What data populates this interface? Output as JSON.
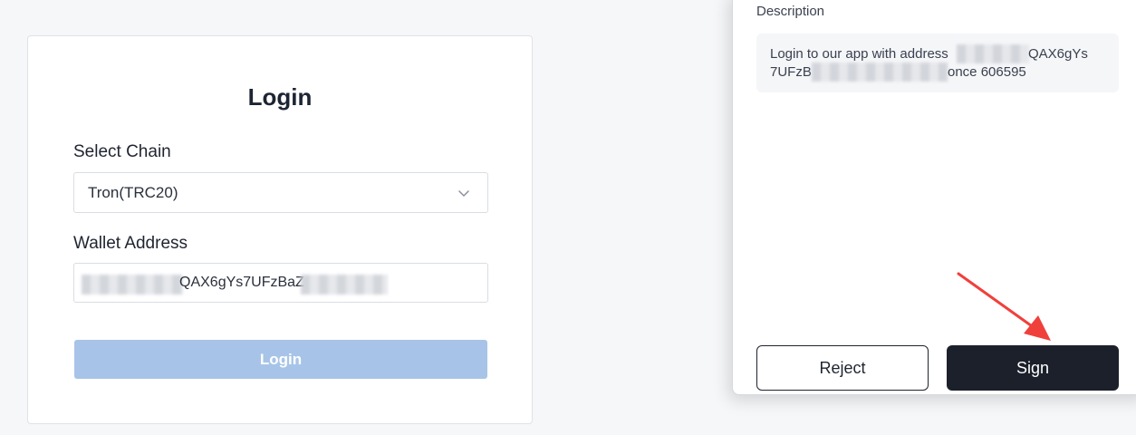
{
  "login": {
    "title": "Login",
    "chain_label": "Select Chain",
    "chain_value": "Tron(TRC20)",
    "address_label": "Wallet Address",
    "address_value_visible": "QAX6gYs7UFzBaZ",
    "button_label": "Login"
  },
  "popup": {
    "description_label": "Description",
    "description_line1": "Login to our app with address",
    "description_line1_end": "QAX6gYs",
    "description_line2_start": "7UFzB",
    "description_line2_end": "once 606595",
    "reject_label": "Reject",
    "sign_label": "Sign"
  },
  "icons": {
    "chevron": "chevron-down-icon",
    "arrow": "pointer-arrow-icon"
  },
  "colors": {
    "login_button_disabled": "#a7c4e8",
    "sign_button": "#1b202b",
    "annotation_arrow": "#f0403c"
  }
}
